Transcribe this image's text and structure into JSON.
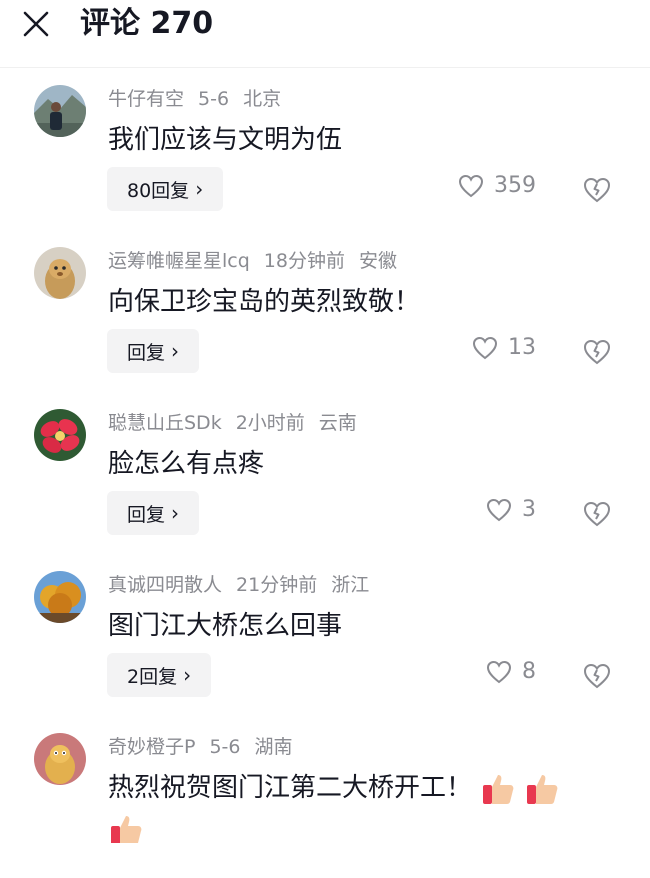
{
  "header": {
    "title": "评论 270"
  },
  "comments": [
    {
      "user": "牛仔有空",
      "time": "5-6",
      "location": "北京",
      "text": "我们应该与文明为伍",
      "reply": "80回复",
      "likes": "359"
    },
    {
      "user": "运筹帷幄星星lcq",
      "time": "18分钟前",
      "location": "安徽",
      "text": "向保卫珍宝岛的英烈致敬！",
      "reply": "回复",
      "likes": "13"
    },
    {
      "user": "聪慧山丘SDk",
      "time": "2小时前",
      "location": "云南",
      "text": "脸怎么有点疼",
      "reply": "回复",
      "likes": "3"
    },
    {
      "user": "真诚四明散人",
      "time": "21分钟前",
      "location": "浙江",
      "text": "图门江大桥怎么回事",
      "reply": "2回复",
      "likes": "8"
    },
    {
      "user": "奇妙橙子P",
      "time": "5-6",
      "location": "湖南",
      "text": "热烈祝贺图门江第二大桥开工！"
    }
  ],
  "icons": {
    "close": "close-icon",
    "like": "heart-outline-icon",
    "dislike": "broken-heart-icon",
    "reply_chevron": "chevron-right-icon",
    "emoji": "thumbs-up-emoji"
  },
  "colors": {
    "meta": "#8a8b91",
    "text": "#161823",
    "reply_bg": "#f3f3f4"
  }
}
